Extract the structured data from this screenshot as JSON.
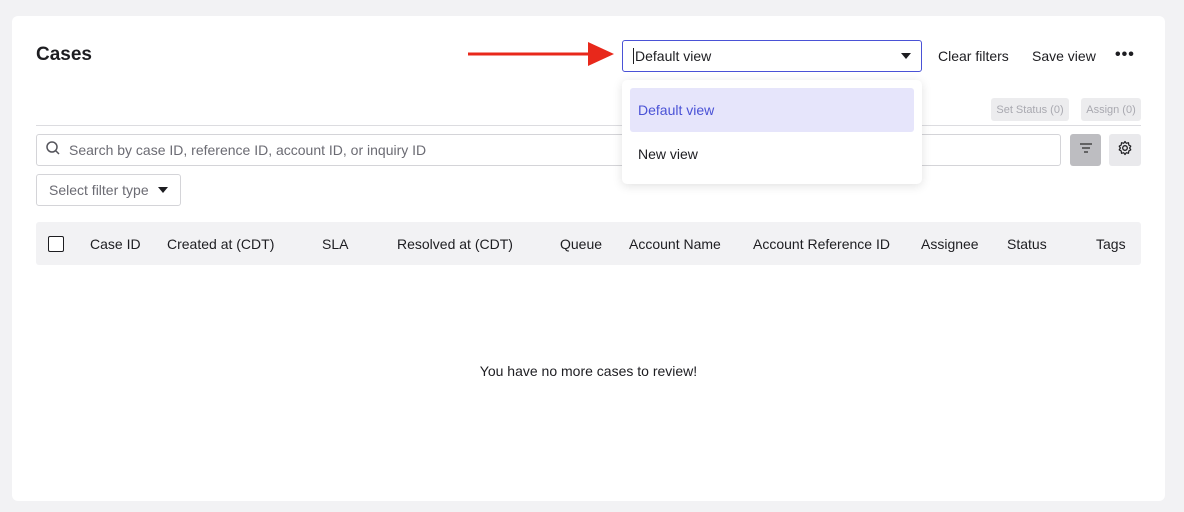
{
  "header": {
    "title": "Cases",
    "view_select_value": "Default view",
    "clear_filters_label": "Clear filters",
    "save_view_label": "Save view",
    "more_label": "•••"
  },
  "bulk_actions": {
    "set_status_label": "Set Status (0)",
    "assign_label": "Assign (0)"
  },
  "search": {
    "placeholder": "Search by case ID, reference ID, account ID, or inquiry ID"
  },
  "filter": {
    "filter_type_placeholder": "Select filter type"
  },
  "table": {
    "columns": [
      "Case ID",
      "Created at (CDT)",
      "SLA",
      "Resolved at (CDT)",
      "Queue",
      "Account Name",
      "Account Reference ID",
      "Assignee",
      "Status",
      "Tags"
    ],
    "empty_message": "You have no more cases to review!"
  },
  "view_dropdown": {
    "options": [
      "Default view",
      "New view"
    ],
    "selected": "Default view"
  },
  "colors": {
    "accent": "#4a52d6",
    "annotation_arrow": "#e8281b"
  },
  "icons": {
    "search": "search-icon",
    "filter": "filter-icon",
    "settings": "gear-icon",
    "annotation": "arrow-right-icon"
  }
}
